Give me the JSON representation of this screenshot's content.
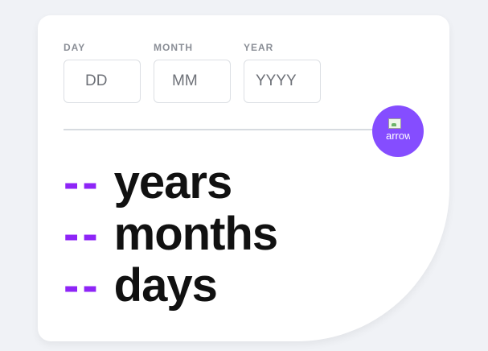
{
  "fields": {
    "day": {
      "label": "DAY",
      "placeholder": "DD",
      "value": ""
    },
    "month": {
      "label": "MONTH",
      "placeholder": "MM",
      "value": ""
    },
    "year": {
      "label": "YEAR",
      "placeholder": "YYYY",
      "value": ""
    }
  },
  "submit": {
    "alt_text": "arrow",
    "icon": "broken-image-icon"
  },
  "results": [
    {
      "value": "--",
      "unit": "years"
    },
    {
      "value": "--",
      "unit": "months"
    },
    {
      "value": "--",
      "unit": "days"
    }
  ],
  "colors": {
    "accent": "#854dff",
    "result_value": "#8e25f7",
    "background": "#f0f2f6",
    "card": "#ffffff",
    "label": "#8a8e96",
    "text": "#111111"
  }
}
